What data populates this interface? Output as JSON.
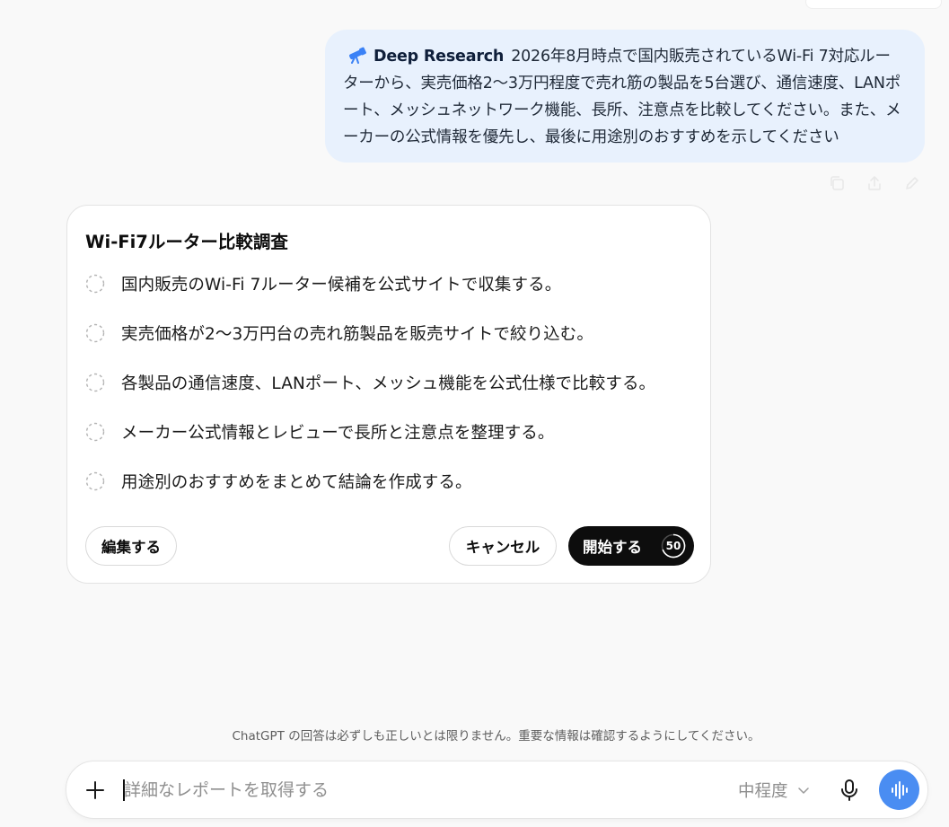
{
  "user_message": {
    "mode_label": "Deep Research",
    "text": "2026年8月時点で国内販売されているWi-Fi 7対応ルーターから、実売価格2〜3万円程度で売れ筋の製品を5台選び、通信速度、LANポート、メッシュネットワーク機能、長所、注意点を比較してください。また、メーカーの公式情報を優先し、最後に用途別のおすすめを示してください"
  },
  "message_actions": [
    {
      "icon": "copy-icon"
    },
    {
      "icon": "share-icon"
    },
    {
      "icon": "edit-icon"
    }
  ],
  "plan": {
    "title": "Wi-Fi7ルーター比較調査",
    "steps": [
      {
        "text": "国内販売のWi-Fi 7ルーター候補を公式サイトで収集する。"
      },
      {
        "text": "実売価格が2〜3万円台の売れ筋製品を販売サイトで絞り込む。"
      },
      {
        "text": "各製品の通信速度、LANポート、メッシュ機能を公式仕様で比較する。"
      },
      {
        "text": "メーカー公式情報とレビューで長所と注意点を整理する。"
      },
      {
        "text": "用途別のおすすめをまとめて結論を作成する。"
      }
    ],
    "edit_label": "編集する",
    "cancel_label": "キャンセル",
    "start_label": "開始する",
    "countdown": "50"
  },
  "disclaimer": "ChatGPT の回答は必ずしも正しいとは限りません。重要な情報は確認するようにしてください。",
  "composer": {
    "placeholder": "詳細なレポートを取得する",
    "effort_label": "中程度"
  },
  "colors": {
    "user_bubble_bg": "#e8f1fd",
    "start_button_bg": "#0d0d0d",
    "voice_button_bg": "#4a8df2",
    "deep_research_icon": "#3b82f6"
  }
}
